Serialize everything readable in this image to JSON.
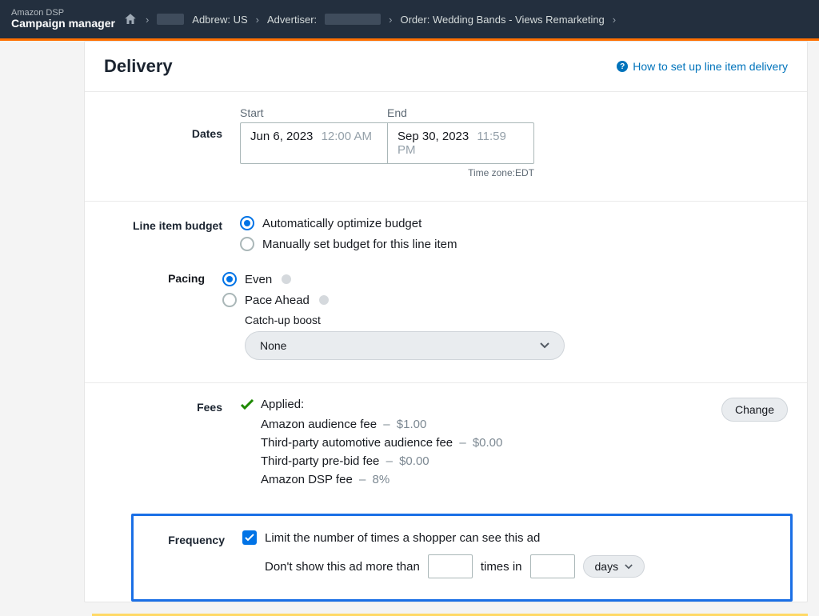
{
  "nav": {
    "app_small": "Amazon DSP",
    "app_big": "Campaign manager",
    "bc1": "Adbrew: US",
    "bc2_prefix": "Advertiser:",
    "bc3": "Order: Wedding Bands - Views Remarketing"
  },
  "header": {
    "title": "Delivery",
    "help_link": "How to set up line item delivery"
  },
  "dates": {
    "label": "Dates",
    "start_label": "Start",
    "end_label": "End",
    "start_date": "Jun 6, 2023",
    "start_time": "12:00 AM",
    "end_date": "Sep 30, 2023",
    "end_time": "11:59 PM",
    "tz": "Time zone:EDT"
  },
  "budget": {
    "label": "Line item budget",
    "opt_auto": "Automatically optimize budget",
    "opt_manual": "Manually set budget for this line item"
  },
  "pacing": {
    "label": "Pacing",
    "opt_even": "Even",
    "opt_ahead": "Pace Ahead",
    "catchup_label": "Catch-up boost",
    "catchup_value": "None"
  },
  "fees": {
    "label": "Fees",
    "applied": "Applied:",
    "change": "Change",
    "rows": [
      {
        "name": "Amazon audience fee",
        "amt": "$1.00"
      },
      {
        "name": "Third-party automotive audience fee",
        "amt": "$0.00"
      },
      {
        "name": "Third-party pre-bid fee",
        "amt": "$0.00"
      },
      {
        "name": "Amazon DSP fee",
        "amt": "8%"
      }
    ]
  },
  "frequency": {
    "label": "Frequency",
    "checkbox_label": "Limit the number of times a shopper can see this ad",
    "text_before": "Don't show this ad more than",
    "text_middle": "times in",
    "unit": "days"
  }
}
